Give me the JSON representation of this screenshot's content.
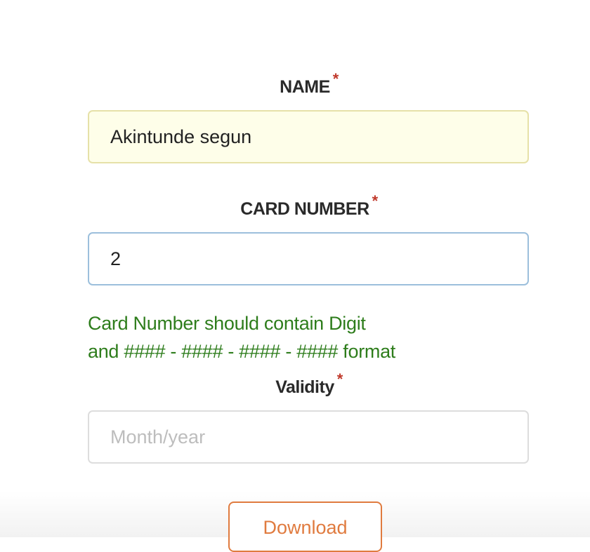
{
  "form": {
    "name": {
      "label": "NAME",
      "required_mark": "*",
      "value": "Akintunde segun"
    },
    "card_number": {
      "label": "CARD NUMBER",
      "required_mark": "*",
      "value": "2",
      "hint_line1": "Card Number should contain Digit",
      "hint_line2": "and #### - #### - #### - #### format"
    },
    "validity": {
      "label": "Validity",
      "required_mark": "*",
      "value": "",
      "placeholder": "Month/year"
    },
    "download_label": "Download"
  },
  "colors": {
    "required": "#c0392b",
    "hint": "#2e7d1c",
    "button": "#e07b3f",
    "name_field_bg": "#fefee9",
    "card_field_border": "#9cbfdc"
  }
}
